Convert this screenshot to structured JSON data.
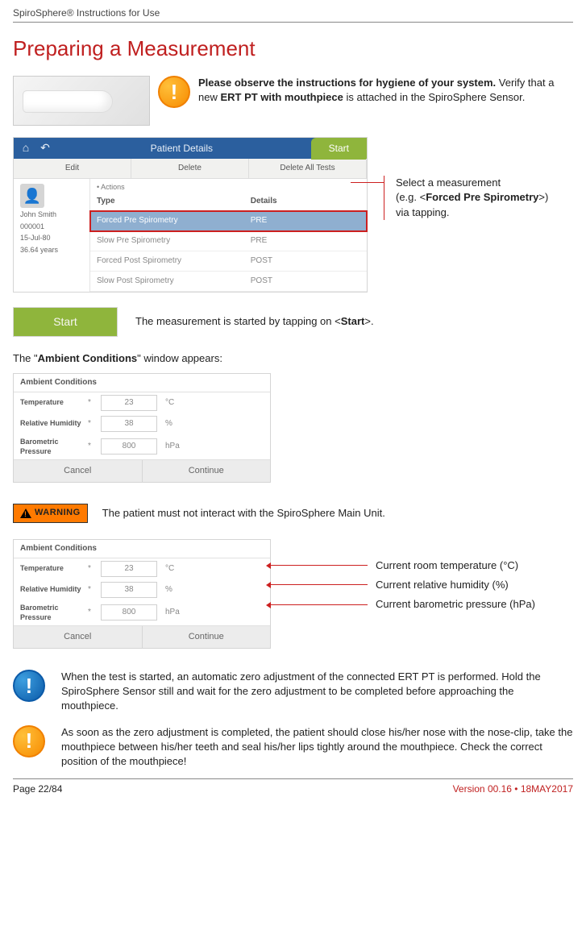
{
  "header": {
    "doc_title": "SpiroSphere® Instructions for Use"
  },
  "title": "Preparing a Measurement",
  "hygiene": {
    "bold1": "Please observe the instructions for hygiene of your system.",
    "rest1": " Verify that a new ",
    "bold2": "ERT PT with mouthpiece",
    "rest2": " is attached in the SpiroSphere Sensor."
  },
  "patient_details": {
    "topbar_title": "Patient Details",
    "start_tab": "Start",
    "toolbar": [
      "Edit",
      "Delete",
      "Delete All Tests"
    ],
    "side": {
      "name": "John Smith",
      "id": "000001",
      "dob": "15-Jul-80",
      "age": "36.64 years"
    },
    "actions_label": "Actions",
    "cols": [
      "Type",
      "Details"
    ],
    "rows": [
      {
        "type": "Forced Pre Spirometry",
        "details": "PRE",
        "hl": true
      },
      {
        "type": "Slow Pre Spirometry",
        "details": "PRE",
        "hl": false
      },
      {
        "type": "Forced Post Spirometry",
        "details": "POST",
        "hl": false
      },
      {
        "type": "Slow Post Spirometry",
        "details": "POST",
        "hl": false
      }
    ]
  },
  "callout_select": {
    "l1": "Select a measurement",
    "l2a": "(e.g. <",
    "l2b": "Forced Pre Spirometry",
    "l2c": ">)",
    "l3": "via tapping."
  },
  "start": {
    "btn": "Start",
    "text_a": "The measurement is started by tapping on <",
    "text_b": "Start",
    "text_c": ">."
  },
  "ambient_intro": {
    "a": "The \"",
    "b": "Ambient Conditions",
    "c": "\" window appears:"
  },
  "ambient": {
    "title": "Ambient Conditions",
    "rows": [
      {
        "label": "Temperature",
        "value": "23",
        "unit": "°C"
      },
      {
        "label": "Relative Humidity",
        "value": "38",
        "unit": "%"
      },
      {
        "label": "Barometric Pressure",
        "value": "800",
        "unit": "hPa"
      }
    ],
    "cancel": "Cancel",
    "continue": "Continue"
  },
  "warning": {
    "label": "WARNING",
    "text": "The patient must not interact with the SpiroSphere Main Unit."
  },
  "annot": {
    "a1": "Current room temperature (°C)",
    "a2": "Current relative humidity (%)",
    "a3": "Current barometric pressure (hPa)"
  },
  "note1": "When the test is started, an automatic zero adjustment of the connected ERT PT is performed. Hold the SpiroSphere Sensor still and wait for the zero adjustment to be completed before approaching the mouthpiece.",
  "note2": "As soon as the zero adjustment is completed, the patient should close his/her nose with the nose-clip, take the mouthpiece between his/her teeth and seal his/her lips tightly around the mouthpiece. Check the correct position of the mouthpiece!",
  "footer": {
    "page": "Page 22/84",
    "version": "Version 00.16 • 18MAY2017"
  }
}
